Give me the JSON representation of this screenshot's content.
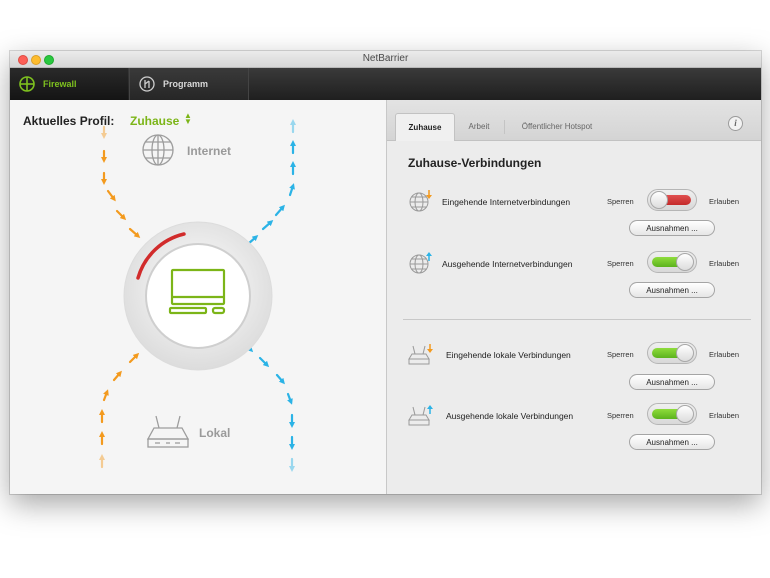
{
  "window": {
    "title": "NetBarrier"
  },
  "toolbar": {
    "tabs": [
      {
        "label": "Firewall",
        "icon": "crosshair-globe-icon",
        "active": true,
        "color": "#7ec11f"
      },
      {
        "label": "Programm",
        "icon": "program-circle-icon",
        "active": false
      }
    ]
  },
  "left": {
    "profile_label": "Aktuelles Profil:",
    "profile_value": "Zuhause",
    "internet_label": "Internet",
    "lokal_label": "Lokal"
  },
  "right": {
    "tabs": [
      {
        "label": "Zuhause",
        "active": true
      },
      {
        "label": "Arbeit",
        "active": false
      },
      {
        "label": "Öffentlicher Hotspot",
        "active": false
      }
    ],
    "section_title": "Zuhause-Verbindungen",
    "rows": [
      {
        "label": "Eingehende Internetverbindungen",
        "icon": "globe-incoming-icon",
        "sperren": "Sperren",
        "erlauben": "Erlauben",
        "state": "blocked",
        "button": "Ausnahmen ..."
      },
      {
        "label": "Ausgehende Internetverbindungen",
        "icon": "globe-outgoing-icon",
        "sperren": "Sperren",
        "erlauben": "Erlauben",
        "state": "allowed",
        "button": "Ausnahmen ..."
      },
      {
        "label": "Eingehende lokale Verbindungen",
        "icon": "router-incoming-icon",
        "sperren": "Sperren",
        "erlauben": "Erlauben",
        "state": "allowed",
        "button": "Ausnahmen ..."
      },
      {
        "label": "Ausgehende lokale Verbindungen",
        "icon": "router-outgoing-icon",
        "sperren": "Sperren",
        "erlauben": "Erlauben",
        "state": "allowed",
        "button": "Ausnahmen ..."
      }
    ]
  },
  "colors": {
    "accent_green": "#7cb518",
    "block_red": "#c42a2a",
    "arrow_orange": "#f39a1e",
    "arrow_blue": "#2bb3e6"
  }
}
